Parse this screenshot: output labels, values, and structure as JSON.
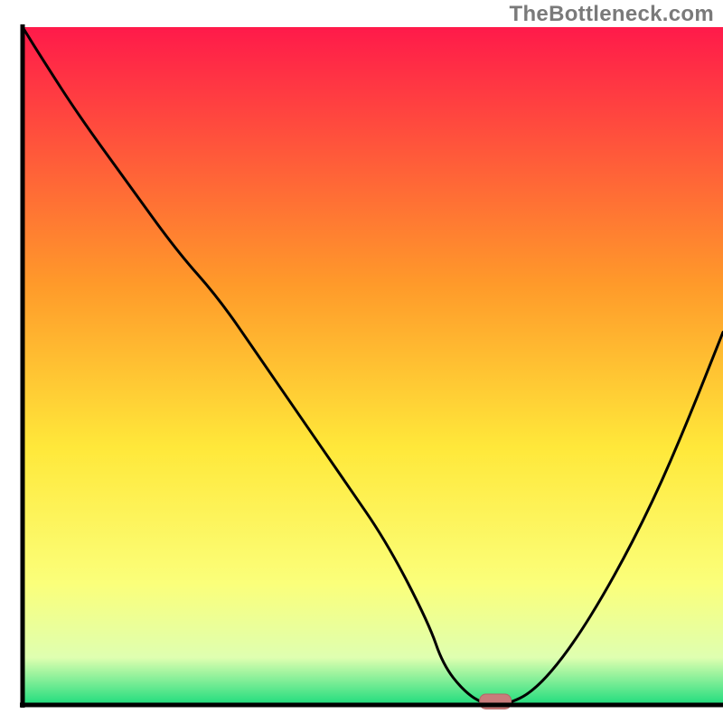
{
  "watermark": "TheBottleneck.com",
  "colors": {
    "axis": "#000000",
    "curve": "#000000",
    "marker_fill": "#c97b7b",
    "marker_stroke": "#b46666",
    "grad_top": "#ff1a4a",
    "grad_mid1": "#ff9a2a",
    "grad_mid2": "#ffe83a",
    "grad_mid3": "#fbff7a",
    "grad_bottom_band": "#dfffb0",
    "grad_bottom": "#1edc7d"
  },
  "chart_data": {
    "type": "line",
    "title": "",
    "xlabel": "",
    "ylabel": "",
    "xlim": [
      0,
      100
    ],
    "ylim": [
      0,
      100
    ],
    "x": [
      0,
      3,
      8,
      15,
      22,
      28,
      34,
      40,
      46,
      52,
      58,
      60,
      63,
      66,
      69,
      73,
      78,
      84,
      90,
      95,
      100
    ],
    "values": [
      100,
      95,
      87,
      77,
      67,
      60,
      51,
      42,
      33,
      24,
      12,
      6,
      2,
      0,
      0,
      2,
      8,
      18,
      30,
      42,
      55
    ],
    "marker": {
      "x": 67.5,
      "y": 0.5,
      "w": 4.5,
      "h": 2.2
    },
    "legend": []
  }
}
